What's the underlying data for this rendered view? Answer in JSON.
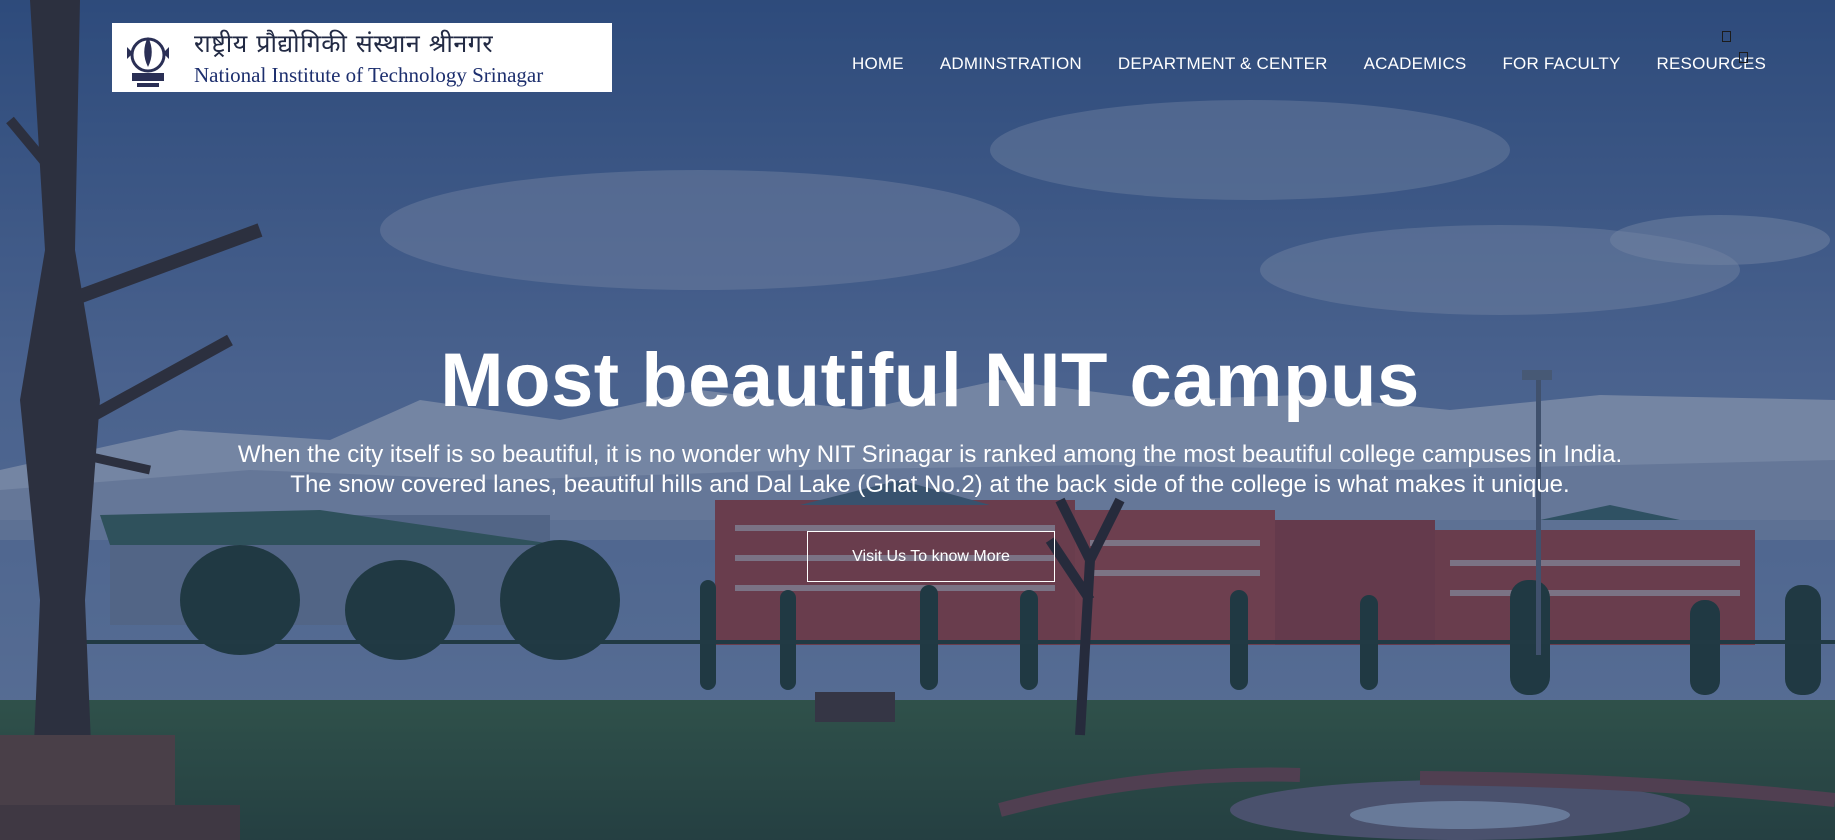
{
  "header": {
    "logo": {
      "hindi_name": "राष्ट्रीय प्रौद्योगिकी संस्थान श्रीनगर",
      "english_name": "National Institute of Technology Srinagar"
    },
    "nav": [
      {
        "label": "HOME"
      },
      {
        "label": "ADMINSTRATION"
      },
      {
        "label": "DEPARTMENT & CENTER"
      },
      {
        "label": "ACADEMICS"
      },
      {
        "label": "FOR FACULTY"
      },
      {
        "label": "RESOURCES"
      }
    ]
  },
  "hero": {
    "title": "Most beautiful NIT campus",
    "subtitle_line1": "When the city itself is so beautiful, it is no wonder why NIT Srinagar is ranked among the most beautiful college campuses in India.",
    "subtitle_line2": "The snow covered lanes, beautiful hills and Dal Lake (Ghat No.2) at the back side of the college is what makes it unique.",
    "button_label": "Visit Us To know More"
  },
  "colors": {
    "overlay": "#1c325f",
    "nav_text": "#ffffff",
    "logo_text": "#1d2f6e",
    "building": "#a8453f"
  },
  "icons": {
    "emblem": "institute-emblem-icon",
    "top_right_1": "unknown-glyph-icon",
    "top_right_2": "unknown-glyph-icon"
  }
}
